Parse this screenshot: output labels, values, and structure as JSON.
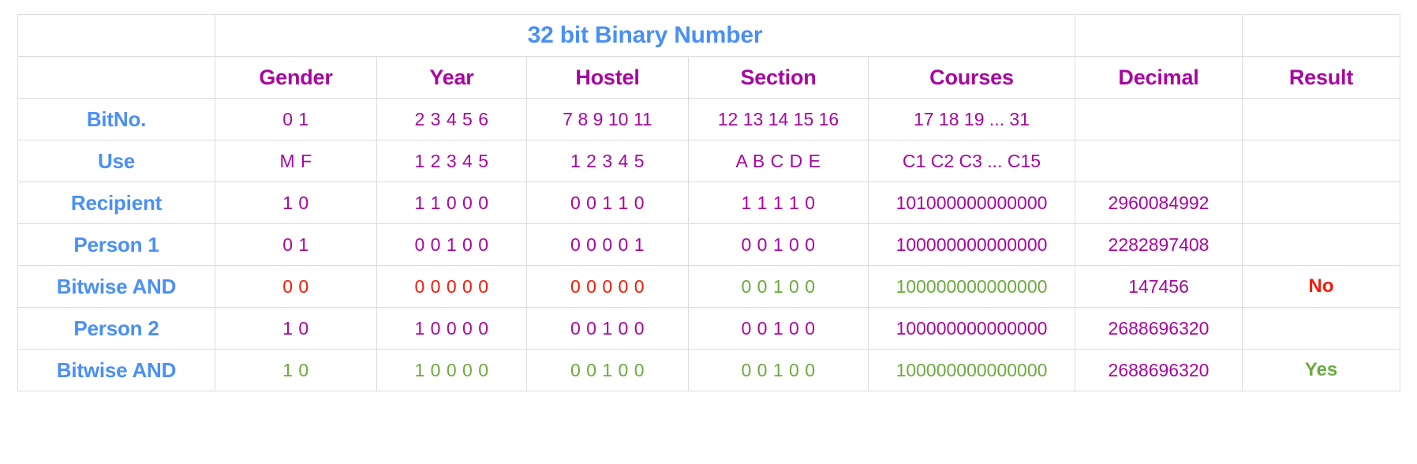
{
  "table": {
    "title": "32 bit Binary Number",
    "column_headers": {
      "corner": "",
      "gender": "Gender",
      "year": "Year",
      "hostel": "Hostel",
      "section": "Section",
      "courses": "Courses",
      "decimal": "Decimal",
      "result": "Result"
    },
    "colors": {
      "row_label": "#4a90f4",
      "title": "#4a90f4",
      "header": "#a8069f",
      "value": "#a8069f",
      "negative": "#f61905",
      "positive": "#6aab3c",
      "grid": "#dcdcdc"
    },
    "rows": [
      {
        "label": "BitNo.",
        "gender": "0 1",
        "year": "2 3 4 5 6",
        "hostel": "7 8 9 10 11",
        "section": "12 13 14 15 16",
        "courses": "17  18  19  ...  31",
        "decimal": "",
        "result": "",
        "value_color": "value",
        "result_color": "value"
      },
      {
        "label": "Use",
        "gender": "M F",
        "year": "1 2 3 4 5",
        "hostel": "1 2 3  4  5",
        "section": "A  B  C  D  E",
        "courses": "C1 C2 C3 ... C15",
        "decimal": "",
        "result": "",
        "value_color": "value",
        "result_color": "value"
      },
      {
        "label": "Recipient",
        "gender": "1 0",
        "year": "1 1 0 0 0",
        "hostel": "0 0 1 1 0",
        "section": "1 1 1 1 0",
        "courses": "101000000000000",
        "decimal": "2960084992",
        "result": "",
        "value_color": "value",
        "result_color": "value"
      },
      {
        "label": "Person 1",
        "gender": "0 1",
        "year": "0 0 1 0 0",
        "hostel": "0 0 0 0 1",
        "section": "0 0 1 0 0",
        "courses": "100000000000000",
        "decimal": "2282897408",
        "result": "",
        "value_color": "value",
        "result_color": "value"
      },
      {
        "label": "Bitwise AND",
        "gender": "0 0",
        "year": "0 0 0 0 0",
        "hostel": "0 0 0 0 0",
        "section": "0 0 1 0 0",
        "courses": "100000000000000",
        "decimal": "147456",
        "result": "No",
        "gender_color": "negative",
        "year_color": "negative",
        "hostel_color": "negative",
        "section_color": "positive",
        "courses_color": "positive",
        "decimal_color": "value",
        "result_color": "negative"
      },
      {
        "label": "Person 2",
        "gender": "1 0",
        "year": "1 0 0 0 0",
        "hostel": "0 0 1 0 0",
        "section": "0 0 1 0 0",
        "courses": "100000000000000",
        "decimal": "2688696320",
        "result": "",
        "value_color": "value",
        "result_color": "value"
      },
      {
        "label": "Bitwise AND",
        "gender": "1 0",
        "year": "1 0 0 0 0",
        "hostel": "0 0 1 0 0",
        "section": "0 0 1 0 0",
        "courses": "100000000000000",
        "decimal": "2688696320",
        "result": "Yes",
        "gender_color": "positive",
        "year_color": "positive",
        "hostel_color": "positive",
        "section_color": "positive",
        "courses_color": "positive",
        "decimal_color": "value",
        "result_color": "positive"
      }
    ]
  }
}
